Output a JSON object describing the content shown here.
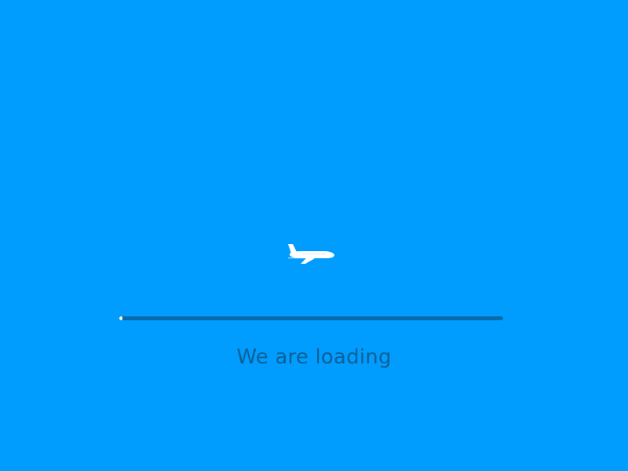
{
  "loading": {
    "message": "We are loading",
    "progress_fraction": 0.008
  },
  "icons": {
    "plane": "airplane-icon"
  },
  "colors": {
    "background": "#009dff",
    "track": "#0a6aa8",
    "fill": "#ffffff",
    "text": "#0d5f96",
    "plane": "#ffffff"
  }
}
